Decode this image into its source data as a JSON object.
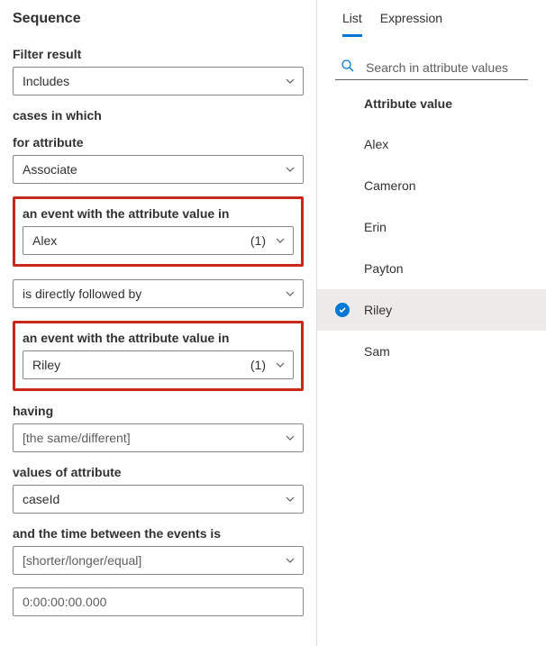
{
  "left": {
    "title": "Sequence",
    "filterResult": {
      "label": "Filter result",
      "value": "Includes"
    },
    "casesIn": "cases in which",
    "forAttribute": {
      "label": "for attribute",
      "value": "Associate"
    },
    "event1": {
      "label": "an event with the attribute value in",
      "value": "Alex",
      "count": "(1)"
    },
    "relation": {
      "value": "is directly followed by"
    },
    "event2": {
      "label": "an event with the attribute value in",
      "value": "Riley",
      "count": "(1)"
    },
    "having": {
      "label": "having",
      "placeholder": "[the same/different]"
    },
    "valuesOf": {
      "label": "values of attribute",
      "value": "caseId"
    },
    "timeBetween": {
      "label": "and the time between the events is",
      "placeholder": "[shorter/longer/equal]"
    },
    "duration": {
      "value": "0:00:00:00.000"
    }
  },
  "right": {
    "tabs": {
      "list": "List",
      "expression": "Expression"
    },
    "searchPlaceholder": "Search in attribute values",
    "listHeader": "Attribute value",
    "items": [
      {
        "label": "Alex",
        "selected": false
      },
      {
        "label": "Cameron",
        "selected": false
      },
      {
        "label": "Erin",
        "selected": false
      },
      {
        "label": "Payton",
        "selected": false
      },
      {
        "label": "Riley",
        "selected": true
      },
      {
        "label": "Sam",
        "selected": false
      }
    ]
  }
}
